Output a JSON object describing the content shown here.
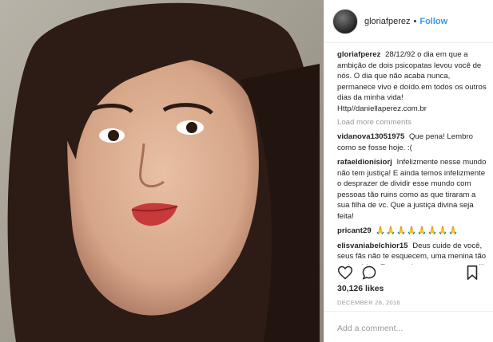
{
  "header": {
    "username": "gloriafperez",
    "separator": "•",
    "follow_label": "Follow"
  },
  "caption": {
    "username": "gloriafperez",
    "text": "28/12/92 o dia em que a ambição de dois psicopatas levou você de nós. O dia que não acaba nunca, permanece vivo e doído.em todos os outros dias da minha vida! Http//daniellaperez.com.br"
  },
  "load_more_label": "Load more comments",
  "comments": [
    {
      "username": "vidanova13051975",
      "text": "Que pena! Lembro como se fosse hoje. :("
    },
    {
      "username": "rafaeldionisiorj",
      "text": "Infelizmente nesse mundo não tem justiça! E ainda temos infelizmente o desprazer de dividir esse mundo com pessoas tão ruins como as que tiraram a sua filha de vc. Que a justiça divina seja feita!"
    },
    {
      "username": "pricant29",
      "text": "🙏🙏🙏🙏🙏🙏🙏🙏"
    },
    {
      "username": "elisvaniabelchior15",
      "text": "Deus cuide de você, seus fãs não te esquecem, uma menina tão carismática. Eu era criança, mas era sua fã"
    }
  ],
  "likes": "30,126 likes",
  "date": "DECEMBER 28, 2016",
  "add_comment_placeholder": "Add a comment...",
  "icons": {
    "like": "heart-icon",
    "comment": "comment-icon",
    "save": "bookmark-icon"
  },
  "colors": {
    "accent": "#3897f0",
    "text": "#262626",
    "muted": "#999999",
    "border": "#efefef"
  }
}
